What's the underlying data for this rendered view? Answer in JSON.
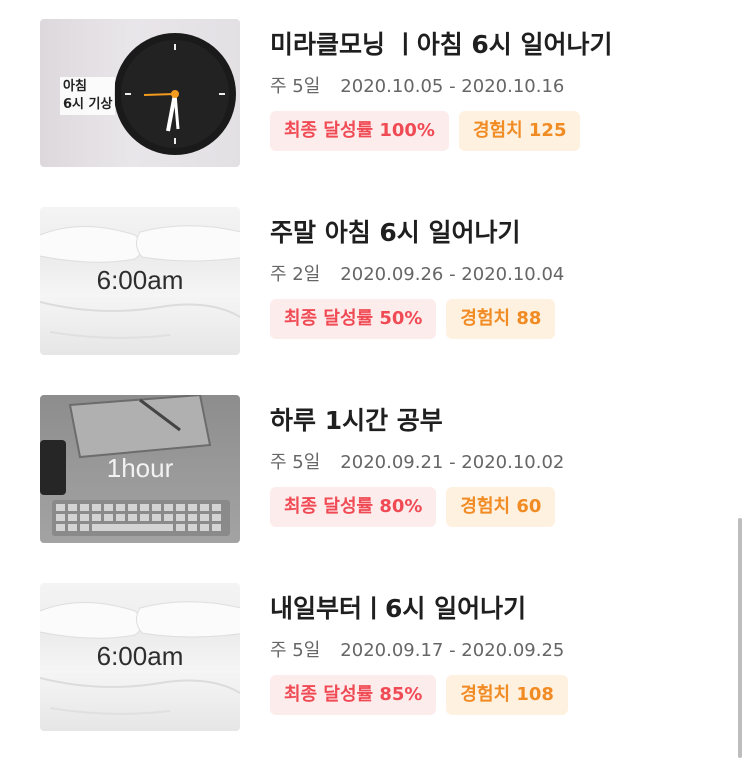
{
  "challenges": [
    {
      "title": "미라클모닝 ㅣ아침 6시 일어나기",
      "frequency": "주 5일",
      "period": "2020.10.05 - 2020.10.16",
      "rate_badge": "최종 달성률 100%",
      "xp_badge": "경험치 125",
      "thumb_kind": "clock",
      "thumb_text": "아침\n6시 기상"
    },
    {
      "title": "주말 아침 6시 일어나기",
      "frequency": "주 2일",
      "period": "2020.09.26 - 2020.10.04",
      "rate_badge": "최종 달성률 50%",
      "xp_badge": "경험치 88",
      "thumb_kind": "bed",
      "thumb_text": "6:00am"
    },
    {
      "title": "하루 1시간 공부",
      "frequency": "주 5일",
      "period": "2020.09.21 - 2020.10.02",
      "rate_badge": "최종 달성률 80%",
      "xp_badge": "경험치 60",
      "thumb_kind": "desk",
      "thumb_text": "1hour"
    },
    {
      "title": "내일부터ㅣ6시 일어나기",
      "frequency": "주 5일",
      "period": "2020.09.17 - 2020.09.25",
      "rate_badge": "최종 달성률 85%",
      "xp_badge": "경험치 108",
      "thumb_kind": "bed",
      "thumb_text": "6:00am"
    }
  ],
  "colors": {
    "rate_text": "#f04b55",
    "rate_bg": "#fdecec",
    "xp_text": "#f18b24",
    "xp_bg": "#fff1e0"
  }
}
